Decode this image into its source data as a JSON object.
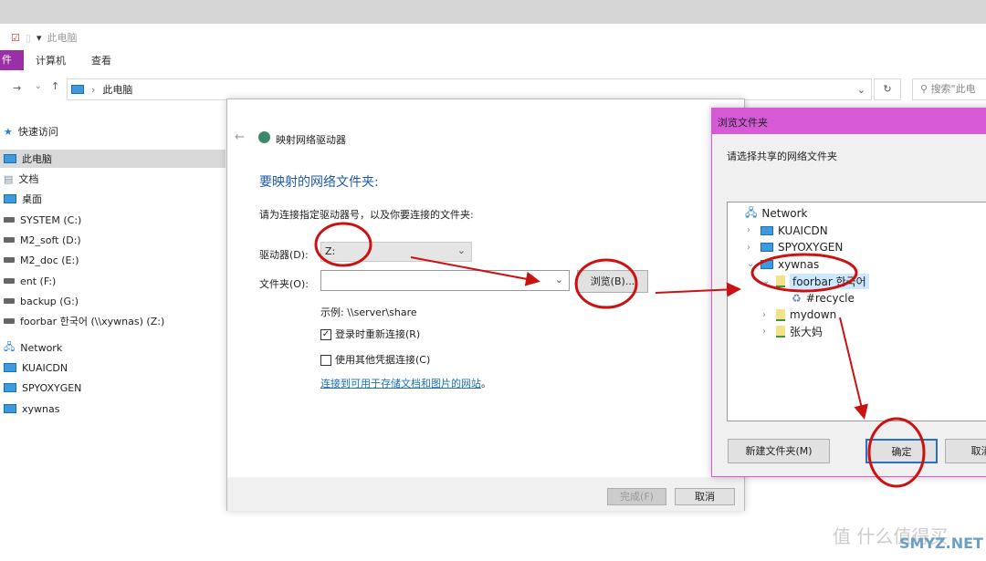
{
  "window": {
    "title": "此电脑",
    "ribbon_tabs": [
      "件",
      "计算机",
      "查看"
    ],
    "address": "此电脑",
    "search_placeholder": "搜索\"此电"
  },
  "sidebar": {
    "items": [
      {
        "label": "快速访问",
        "icon": "star-icon"
      },
      {
        "label": "此电脑",
        "icon": "pc-icon",
        "selected": true
      },
      {
        "label": "文档",
        "icon": "document-icon"
      },
      {
        "label": "桌面",
        "icon": "desktop-icon"
      },
      {
        "label": "SYSTEM (C:)",
        "icon": "drive-icon"
      },
      {
        "label": "M2_soft (D:)",
        "icon": "drive-icon"
      },
      {
        "label": "M2_doc (E:)",
        "icon": "drive-icon"
      },
      {
        "label": "ent (F:)",
        "icon": "drive-icon"
      },
      {
        "label": "backup (G:)",
        "icon": "drive-icon"
      },
      {
        "label": "foorbar 한국어 (\\\\xywnas) (Z:)",
        "icon": "network-drive-icon"
      },
      {
        "label": "Network",
        "icon": "network-icon"
      },
      {
        "label": "KUAICDN",
        "icon": "pc-icon"
      },
      {
        "label": "SPYOXYGEN",
        "icon": "pc-icon"
      },
      {
        "label": "xywnas",
        "icon": "pc-icon"
      }
    ]
  },
  "map_dialog": {
    "title": "映射网络驱动器",
    "heading": "要映射的网络文件夹:",
    "instruction": "请为连接指定驱动器号，以及你要连接的文件夹:",
    "drive_label": "驱动器(D):",
    "drive_value": "Z:",
    "folder_label": "文件夹(O):",
    "folder_value": "",
    "browse_button": "浏览(B)...",
    "example": "示例: \\\\server\\share",
    "reconnect_label": "登录时重新连接(R)",
    "reconnect_checked": true,
    "credentials_label": "使用其他凭据连接(C)",
    "credentials_checked": false,
    "link": "连接到可用于存储文档和图片的网站",
    "link_suffix": "。",
    "finish_button": "完成(F)",
    "cancel_button": "取消"
  },
  "browse_dialog": {
    "title": "浏览文件夹",
    "prompt": "请选择共享的网络文件夹",
    "tree": [
      {
        "label": "Network",
        "level": 0,
        "expander": ""
      },
      {
        "label": "KUAICDN",
        "level": 1,
        "expander": "›"
      },
      {
        "label": "SPYOXYGEN",
        "level": 1,
        "expander": "›"
      },
      {
        "label": "xywnas",
        "level": 1,
        "expander": "⌄"
      },
      {
        "label": "foorbar 한국어",
        "level": 2,
        "expander": "⌄",
        "selected": true
      },
      {
        "label": "#recycle",
        "level": 3,
        "expander": ""
      },
      {
        "label": "mydown",
        "level": 2,
        "expander": "›"
      },
      {
        "label": "张大妈",
        "level": 2,
        "expander": "›"
      }
    ],
    "new_folder_button": "新建文件夹(M)",
    "ok_button": "确定",
    "cancel_button": "取消"
  },
  "watermark": {
    "text": "值 什么值得买",
    "site": "SMYZ.NET"
  },
  "colors": {
    "accent_purple": "#9b2fa6",
    "dialog_title": "#d65ad6",
    "heading_blue": "#1e5aa8",
    "annotation_red": "#cc1111"
  }
}
